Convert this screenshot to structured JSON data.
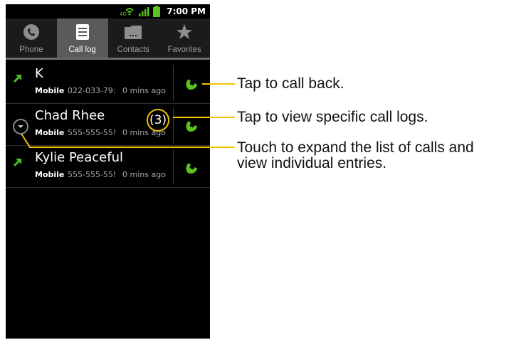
{
  "status_bar": {
    "time": "7:00 PM"
  },
  "tabs": [
    {
      "label": "Phone",
      "icon": "phone-icon",
      "active": false
    },
    {
      "label": "Call log",
      "icon": "call-log-icon",
      "active": true
    },
    {
      "label": "Contacts",
      "icon": "contacts-icon",
      "active": false
    },
    {
      "label": "Favorites",
      "icon": "star-icon",
      "active": false
    }
  ],
  "call_log": [
    {
      "name": "K",
      "type": "Mobile",
      "number": "022-033-79:",
      "time": "0 mins ago",
      "count": ""
    },
    {
      "name": "Chad Rhee",
      "type": "Mobile",
      "number": "555-555-55!",
      "time": "0 mins ago",
      "count": "(3)"
    },
    {
      "name": "Kylie Peaceful",
      "type": "Mobile",
      "number": "555-555-55!",
      "time": "0 mins ago",
      "count": ""
    }
  ],
  "callouts": [
    {
      "text": "Tap to call back."
    },
    {
      "text": "Tap to view specific call logs."
    },
    {
      "text": "Touch to expand the list of calls and"
    },
    {
      "text": "view individual entries."
    }
  ],
  "colors": {
    "highlight": "#f2c200",
    "call_green": "#5cc21c",
    "outgoing_arrow": "#4fbf25"
  }
}
